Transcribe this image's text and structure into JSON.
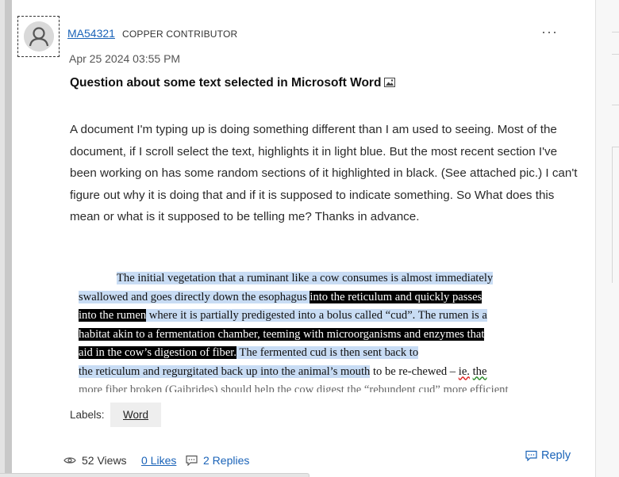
{
  "post": {
    "author": "MA54321",
    "rank": "COPPER CONTRIBUTOR",
    "more": "···",
    "date": "Apr 25 2024  03:55 PM",
    "subject": "Question about some text selected in Microsoft Word",
    "body": "A document I'm typing up is doing something different than I am used to seeing.  Most of the document, if I scroll select the text, highlights it in light blue.  But the most recent section I've been working on has some random sections of it highlighted in black. (See attached pic.)  I can't figure out why it is doing that and if it is supposed to indicate something.  So What does this mean or what is it supposed to be telling me?   Thanks in advance."
  },
  "attachment": {
    "l1": "The initial vegetation that a ruminant like a cow consumes is almost immediately",
    "l2a": "swallowed and goes directly down the esophagus ",
    "l2b": "into the reticulum and quickly passes",
    "l3a": "into the rumen",
    "l3b": " where it is partially predigested into a bolus called “cud”.  The rumen is a",
    "l4": "habitat akin to a fermentation chamber, teeming with microorganisms and enzymes that",
    "l5a": "aid  in  the  cow’s  digestion  of  fiber.",
    "l5b": "  The  fermented  cud  is  then  sent  back  to",
    "l6a": "the reticulum and regurgitated back up into the animal’s mouth",
    "l6b": " to be re-chewed – ",
    "l6c": "ie.",
    "l6d": " ",
    "l6e": "the",
    "l7": "more fiber broken (Gaibrides) should help the cow digest the “rebundent cud” more efficient"
  },
  "labels": {
    "title": "Labels:",
    "items": [
      "Word"
    ]
  },
  "footer": {
    "views": "52 Views",
    "likes": "0 Likes",
    "replies": "2 Replies",
    "reply": "Reply"
  },
  "colors": {
    "link": "#1a63b8",
    "selection_blue": "#c8dcf4",
    "selection_black": "#000000"
  }
}
